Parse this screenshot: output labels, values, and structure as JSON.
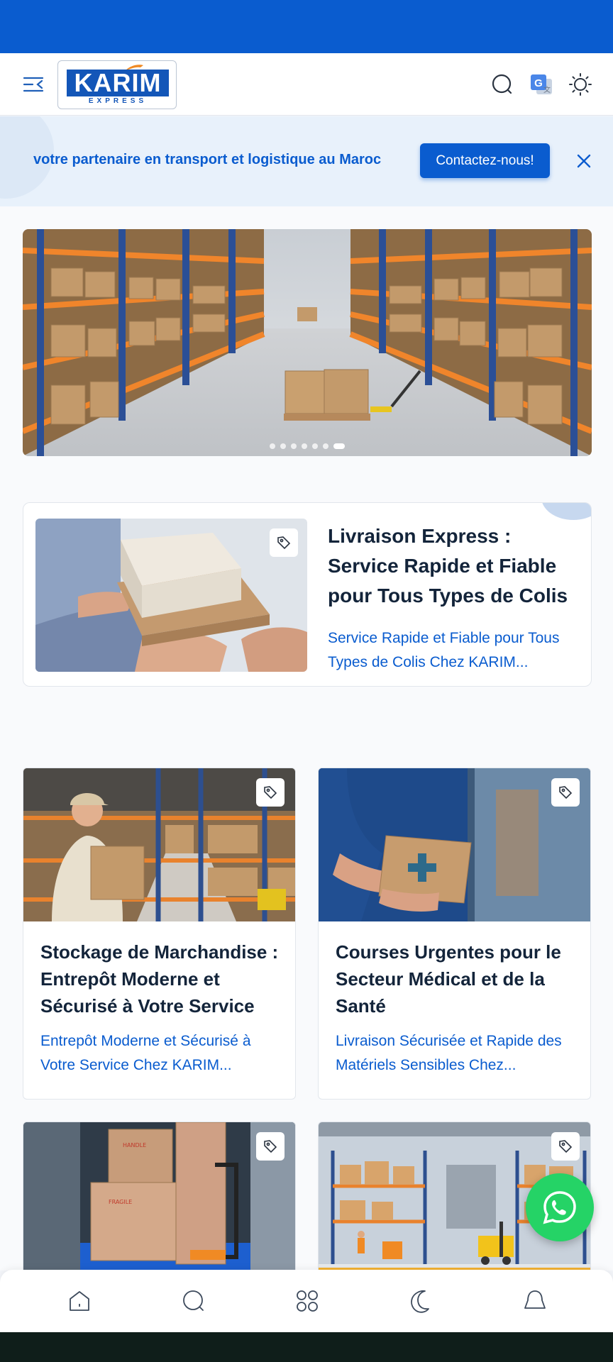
{
  "header": {
    "logo_text": "KARIM",
    "logo_subtext": "EXPRESS",
    "icons": [
      "menu-icon",
      "search-icon",
      "translate-icon",
      "theme-toggle-icon"
    ]
  },
  "banner": {
    "text": "votre partenaire en transport et logistique au Maroc",
    "cta_label": "Contactez-nous!",
    "close_icon": "close-icon"
  },
  "hero": {
    "slide_count": 7,
    "active_slide": 7
  },
  "featured": {
    "title": "Livraison Express : Service Rapide et Fiable pour Tous Types de Colis",
    "description": "Service Rapide et Fiable pour Tous Types de Colis Chez KARIM...",
    "icon": "tag-icon"
  },
  "cards": [
    {
      "title": "Stockage de Marchandise : Entrepôt Moderne et Sécurisé à Votre Service",
      "description": "Entrepôt Moderne et Sécurisé à Votre Service Chez KARIM...",
      "icon": "tag-icon"
    },
    {
      "title": "Courses Urgentes pour le Secteur Médical et de la Santé",
      "description": "Livraison Sécurisée et Rapide des Matériels Sensibles Chez...",
      "icon": "tag-icon"
    },
    {
      "title": "",
      "description": "",
      "icon": "tag-icon"
    },
    {
      "title": "",
      "description": "",
      "icon": "tag-icon"
    }
  ],
  "bottom_nav": [
    "home-icon",
    "search-icon",
    "apps-icon",
    "dark-mode-icon",
    "notifications-icon"
  ],
  "colors": {
    "brand_blue": "#0a5ccf",
    "whatsapp_green": "#25d366"
  }
}
